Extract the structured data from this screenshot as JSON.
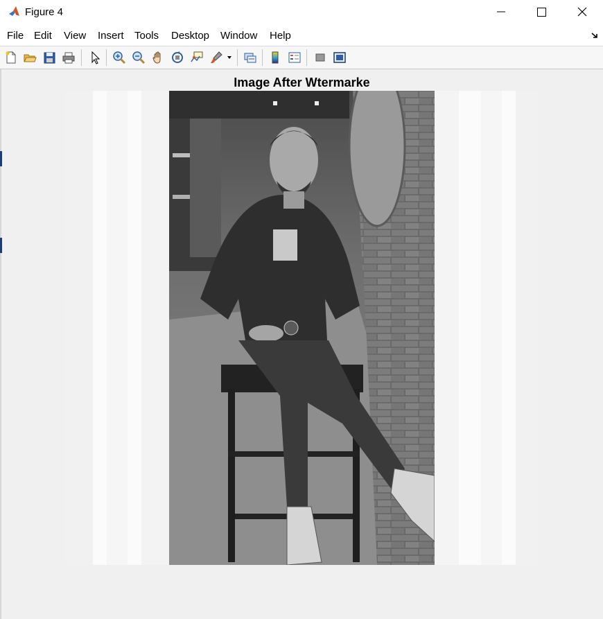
{
  "window": {
    "title": "Figure 4",
    "controls": [
      "minimize",
      "maximize",
      "close"
    ]
  },
  "menu": [
    "File",
    "Edit",
    "View",
    "Insert",
    "Tools",
    "Desktop",
    "Window",
    "Help"
  ],
  "toolbar": [
    "new-figure-icon",
    "open-file-icon",
    "save-icon",
    "print-icon",
    "select-pointer-icon",
    "zoom-in-icon",
    "zoom-out-icon",
    "pan-hand-icon",
    "rotate-3d-icon",
    "data-cursor-icon",
    "brush-icon",
    "brush-dropdown-icon",
    "link-plot-icon",
    "colorbar-icon",
    "legend-icon",
    "hide-plot-tools-icon",
    "show-plot-tools-icon"
  ],
  "axes": {
    "title": "Image After Wtermarke"
  },
  "image": {
    "description_name": "grayscale-watermarked-photo"
  },
  "colors": {
    "window_bg": "#f0f0f0",
    "matlab_orange": "#d9531e",
    "close_x": "#000000"
  }
}
